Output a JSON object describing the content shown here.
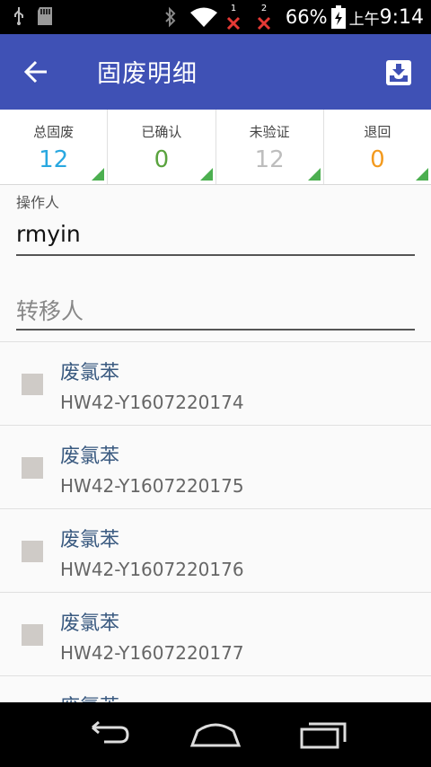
{
  "status_bar": {
    "battery": "66%",
    "ampm": "上午",
    "time": "9:14",
    "icons": [
      "usb-icon",
      "sd-card-icon",
      "bluetooth-icon",
      "wifi-icon",
      "sim1-no-signal-icon",
      "sim2-no-signal-icon",
      "battery-charging-icon"
    ],
    "sim1_label": "1",
    "sim2_label": "2"
  },
  "app_bar": {
    "title": "固废明细",
    "back_icon": "arrow-back-icon",
    "action_icon": "download-tray-icon",
    "color": "#3f51b5"
  },
  "summary": [
    {
      "label": "总固废",
      "value": "12",
      "color": "#29a8e0"
    },
    {
      "label": "已确认",
      "value": "0",
      "color": "#5aa33e"
    },
    {
      "label": "未验证",
      "value": "12",
      "color": "#bdbdbd"
    },
    {
      "label": "退回",
      "value": "0",
      "color": "#f39a1e"
    }
  ],
  "form": {
    "operator_label": "操作人",
    "operator_value": "rmyin",
    "transfer_placeholder": "转移人"
  },
  "items": [
    {
      "name": "废氯苯",
      "code": "HW42-Y1607220174"
    },
    {
      "name": "废氯苯",
      "code": "HW42-Y1607220175"
    },
    {
      "name": "废氯苯",
      "code": "HW42-Y1607220176"
    },
    {
      "name": "废氯苯",
      "code": "HW42-Y1607220177"
    },
    {
      "name": "废氯苯",
      "code": ""
    }
  ],
  "nav_bar": {
    "icons": [
      "nav-back-icon",
      "nav-home-icon",
      "nav-recents-icon"
    ]
  }
}
